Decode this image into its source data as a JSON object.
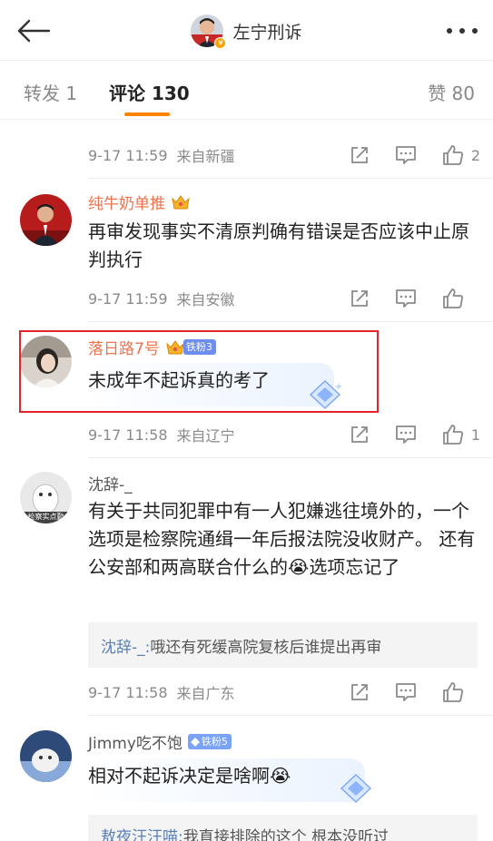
{
  "header": {
    "title": "左宁刑诉",
    "verified_icon": "v-badge-icon"
  },
  "tabs": {
    "repost": "转发 1",
    "comment": "评论 130",
    "like": "赞 80"
  },
  "comments": [
    {
      "time": "9-17 11:59",
      "location": "来自新疆",
      "likes": "2"
    },
    {
      "username": "纯牛奶单推",
      "text": "再审发现事实不清原判确有错误是否应该中止原判执行",
      "time": "9-17 11:59",
      "location": "来自安徽",
      "likes": ""
    },
    {
      "username": "落日路7号",
      "fan_badge": "铁粉3",
      "text": "未成年不起诉真的考了",
      "time": "9-17 11:58",
      "location": "来自辽宁",
      "likes": "1"
    },
    {
      "username": "沈辞-_",
      "avatar_text": "检察实点勤",
      "text": "有关于共同犯罪中有一人犯嫌逃往境外的，一个选项是检察院通缉一年后报法院没收财产。 还有公安部和两高联合什么的😭选项忘记了",
      "reply_author": "沈辞-_:",
      "reply_text": " 哦还有死缓高院复核后谁提出再审",
      "time": "9-17 11:58",
      "location": "来自广东",
      "likes": ""
    },
    {
      "username": "Jimmy吃不饱",
      "fan_badge": "铁粉5",
      "text": "相对不起诉决定是啥啊😭",
      "reply_author": "敖夜汪汪喵:",
      "reply_text": " 我直接排除的这个 根本没听过"
    }
  ],
  "colors": {
    "accent": "#ff8200",
    "vip_name": "#eb7350",
    "highlight": "#e3242b",
    "link": "#5a7fb5"
  },
  "icons": [
    "back-arrow-icon",
    "more-icon",
    "share-icon",
    "comment-icon",
    "like-icon",
    "crown-icon",
    "diamond-icon"
  ]
}
